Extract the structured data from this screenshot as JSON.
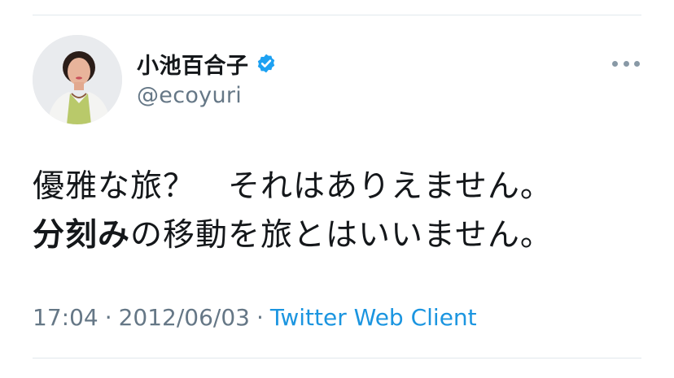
{
  "colors": {
    "accent": "#1da1f2",
    "link": "#1b95e0",
    "secondary_text": "#657786",
    "primary_text": "#14171a",
    "divider": "#e1e8ed"
  },
  "author": {
    "display_name": "小池百合子",
    "handle": "@ecoyuri",
    "verified": true,
    "avatar_icon": "profile-photo",
    "verified_icon": "verified-badge-icon"
  },
  "menu": {
    "icon": "more-options-icon"
  },
  "tweet": {
    "line1": "優雅な旅？　それはありえません。",
    "line2_bold": "分刻み",
    "line2_rest": "の移動を旅とはいいません。"
  },
  "meta": {
    "time": "17:04",
    "separator": "·",
    "date": "2012/06/03",
    "client": "Twitter Web Client"
  }
}
